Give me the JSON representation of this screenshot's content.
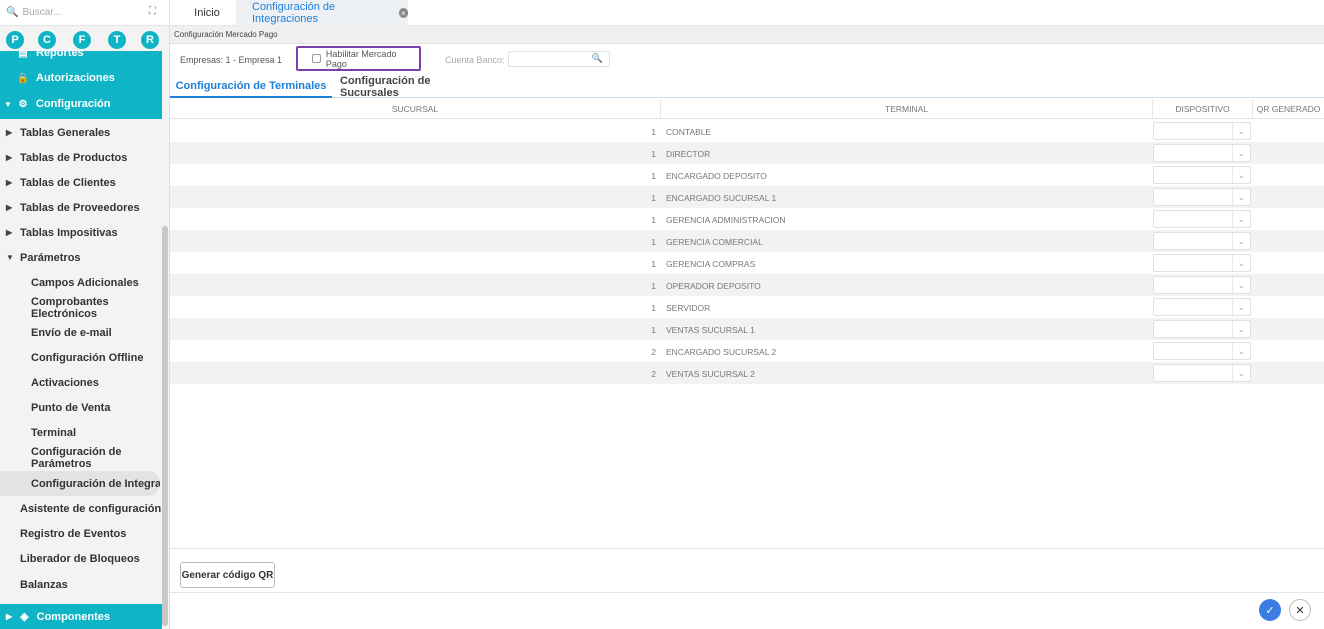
{
  "sidebar": {
    "search_placeholder": "Buscar...",
    "quick_letters": [
      "P",
      "C",
      "F",
      "T",
      "R"
    ],
    "teal_items": [
      {
        "label": "Reportes",
        "icon": "chart-icon"
      },
      {
        "label": "Autorizaciones",
        "icon": "lock-icon"
      },
      {
        "label": "Configuración",
        "icon": "gears-icon"
      }
    ],
    "items": [
      {
        "label": "Tablas Generales"
      },
      {
        "label": "Tablas de Productos"
      },
      {
        "label": "Tablas de Clientes"
      },
      {
        "label": "Tablas de Proveedores"
      },
      {
        "label": "Tablas Impositivas"
      },
      {
        "label": "Parámetros"
      }
    ],
    "sub_items": [
      {
        "label": "Campos Adicionales"
      },
      {
        "label": "Comprobantes Electrónicos"
      },
      {
        "label": "Envío de e-mail"
      },
      {
        "label": "Configuración Offline"
      },
      {
        "label": "Activaciones"
      },
      {
        "label": "Punto de Venta"
      },
      {
        "label": "Terminal"
      },
      {
        "label": "Configuración de Parámetros"
      },
      {
        "label": "Configuración de Integraciones"
      }
    ],
    "top_items": [
      {
        "label": "Asistente de configuración"
      },
      {
        "label": "Registro de Eventos"
      },
      {
        "label": "Liberador de Bloqueos"
      },
      {
        "label": "Balanzas"
      }
    ],
    "components_label": "Componentes",
    "accent_color": "#0fb5c6"
  },
  "tabs": {
    "home": "Inicio",
    "active": "Configuración de Integraciones"
  },
  "panel": {
    "section_title": "Configuración Mercado Pago",
    "empresas_label": "Empresas:  1 - Empresa 1",
    "habilitar_label": "Habilitar Mercado Pago",
    "habilitar_checked": false,
    "cuenta_label": "Cuenta Banco:",
    "cuenta_value": ""
  },
  "subtabs": {
    "terminales": "Configuración de Terminales",
    "sucursales": "Configuración de Sucursales"
  },
  "table": {
    "headers": {
      "sucursal": "SUCURSAL",
      "terminal": "TERMINAL",
      "dispositivo": "DISPOSITIVO",
      "qr": "QR GENERADO"
    },
    "rows": [
      {
        "sucursal": "1",
        "terminal": "CONTABLE"
      },
      {
        "sucursal": "1",
        "terminal": "DIRECTOR"
      },
      {
        "sucursal": "1",
        "terminal": "ENCARGADO DEPOSITO"
      },
      {
        "sucursal": "1",
        "terminal": "ENCARGADO SUCURSAL 1"
      },
      {
        "sucursal": "1",
        "terminal": "GERENCIA ADMINISTRACION"
      },
      {
        "sucursal": "1",
        "terminal": "GERENCIA COMERCIAL"
      },
      {
        "sucursal": "1",
        "terminal": "GERENCIA COMPRAS"
      },
      {
        "sucursal": "1",
        "terminal": "OPERADOR DEPOSITO"
      },
      {
        "sucursal": "1",
        "terminal": "SERVIDOR"
      },
      {
        "sucursal": "1",
        "terminal": "VENTAS SUCURSAL 1"
      },
      {
        "sucursal": "2",
        "terminal": "ENCARGADO SUCURSAL 2"
      },
      {
        "sucursal": "2",
        "terminal": "VENTAS SUCURSAL 2"
      }
    ]
  },
  "footer": {
    "generate_qr": "Generar código QR"
  }
}
